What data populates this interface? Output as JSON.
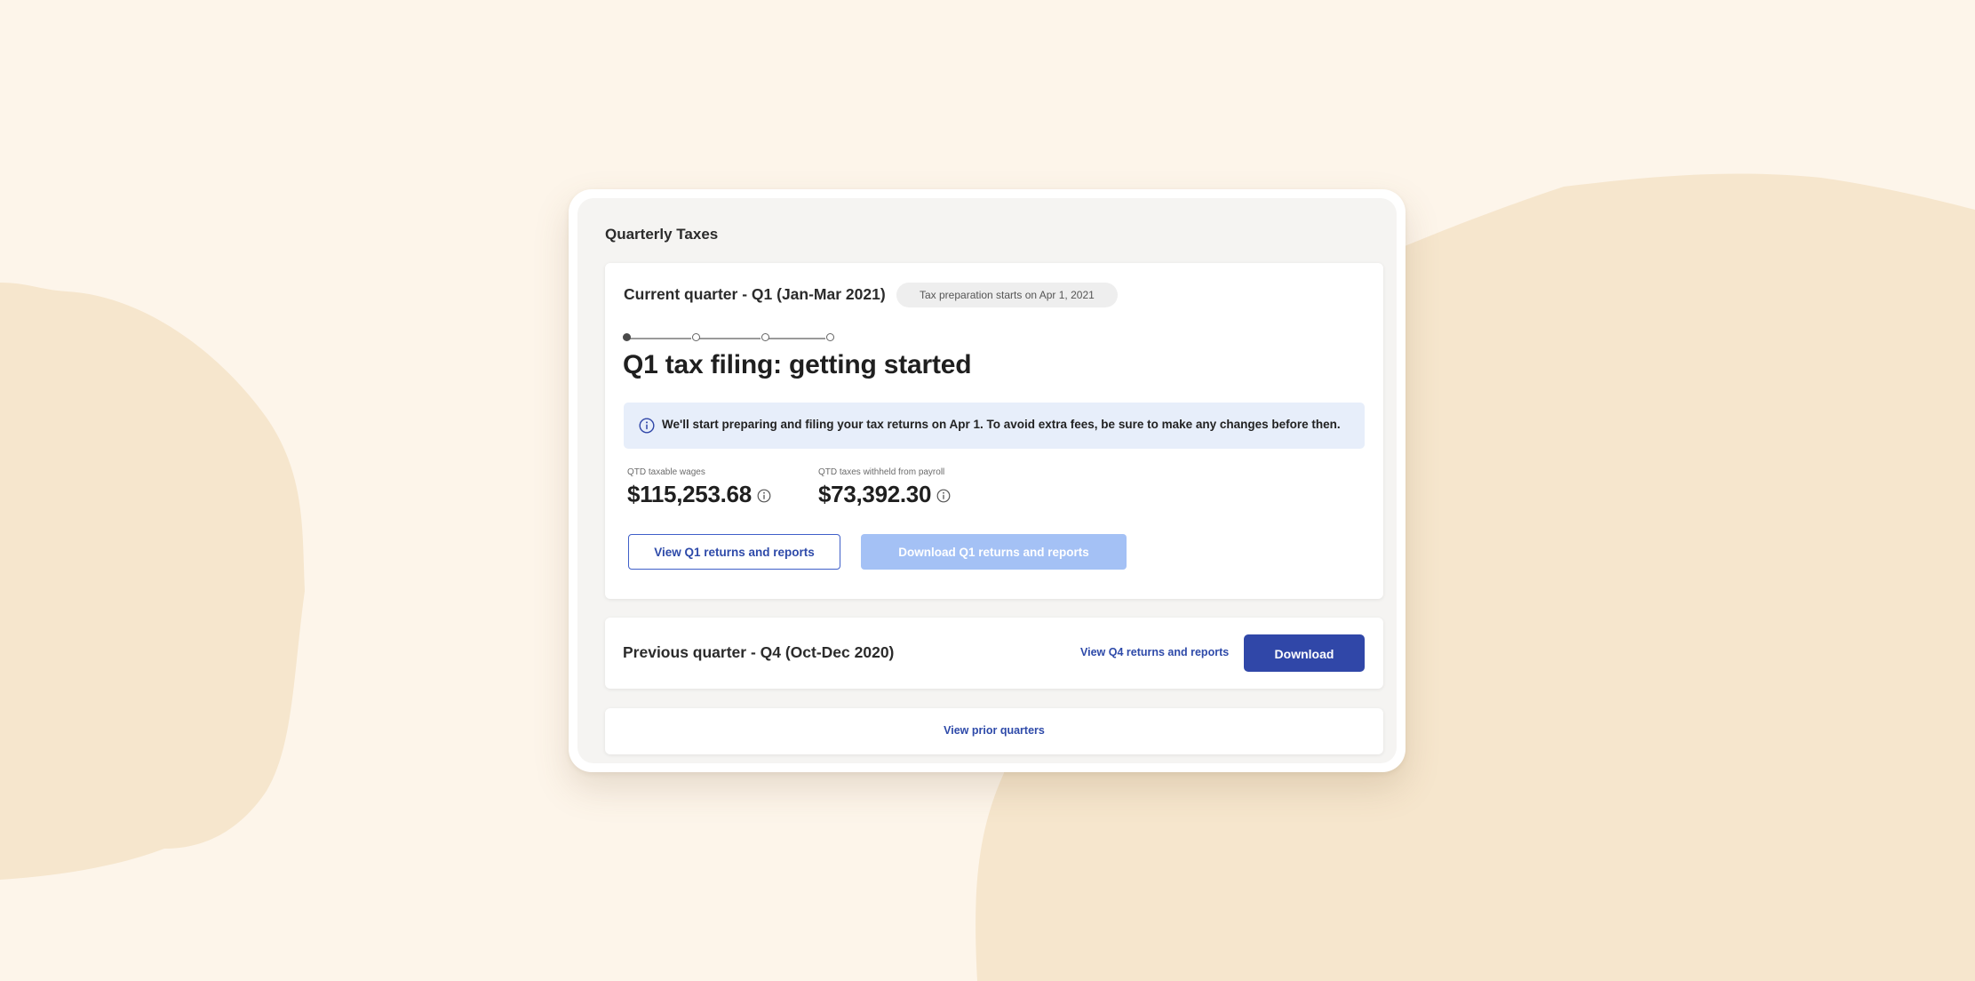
{
  "panel": {
    "title": "Quarterly Taxes"
  },
  "current_quarter": {
    "title": "Current quarter - Q1 (Jan-Mar 2021)",
    "status_pill": "Tax preparation starts on Apr 1, 2021",
    "stepper": {
      "total_steps": 4,
      "active_step": 1
    },
    "heading": "Q1 tax filing: getting started",
    "info_banner": "We'll start preparing and filing your tax returns on Apr 1. To avoid extra fees, be sure to make any changes before then.",
    "stats": [
      {
        "label": "QTD taxable wages",
        "value": "$115,253.68"
      },
      {
        "label": "QTD taxes withheld from payroll",
        "value": "$73,392.30"
      }
    ],
    "view_button": "View Q1 returns and reports",
    "download_button": "Download Q1 returns and reports"
  },
  "previous_quarter": {
    "title": "Previous quarter - Q4 (Oct-Dec 2020)",
    "view_link": "View Q4 returns and reports",
    "download_button": "Download"
  },
  "prior_quarters_link": "View prior quarters",
  "colors": {
    "background": "#fdf5ea",
    "background_shape": "#f6e6cd",
    "primary_blue": "#3047a8",
    "disabled_blue": "#a4c1f5",
    "info_banner_bg": "#e7eefa"
  }
}
